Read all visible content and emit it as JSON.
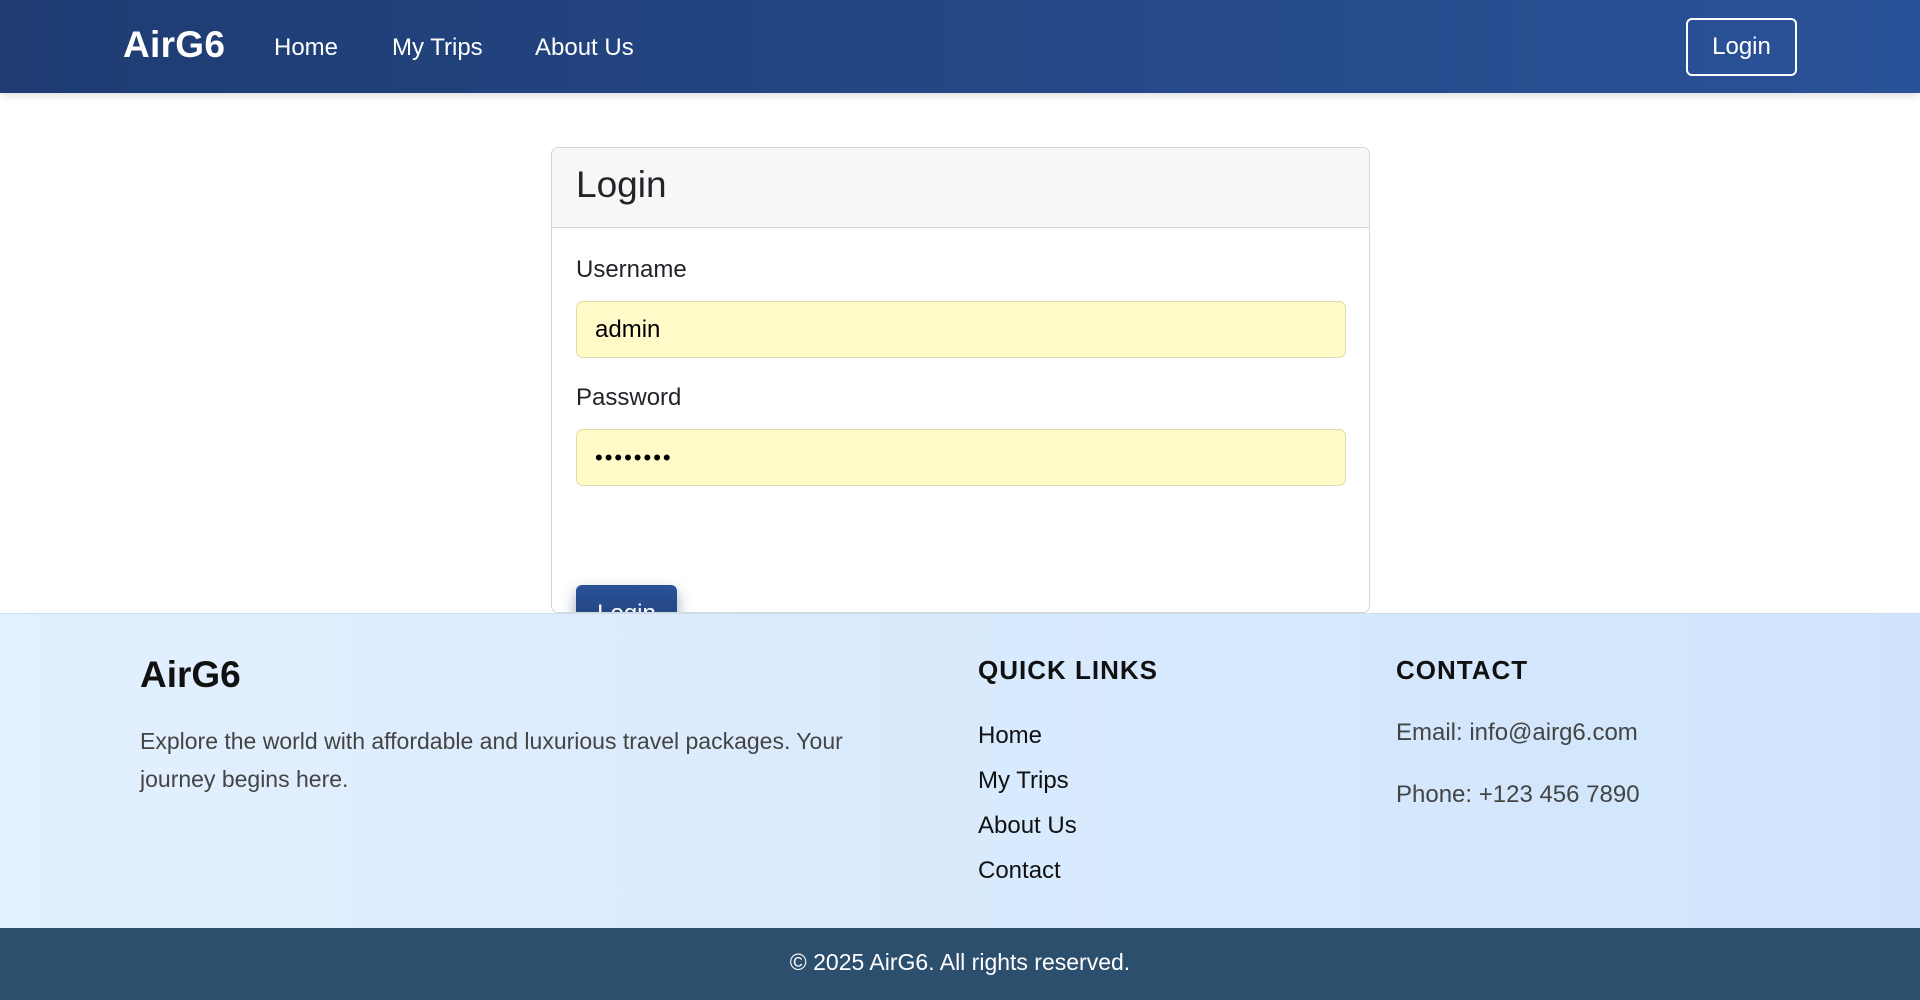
{
  "navbar": {
    "brand": "AirG6",
    "links": [
      "Home",
      "My Trips",
      "About Us"
    ],
    "login_label": "Login"
  },
  "login_card": {
    "title": "Login",
    "username_label": "Username",
    "username_value": "admin",
    "password_label": "Password",
    "password_value": "••••••••",
    "submit_label": "Login"
  },
  "footer": {
    "brand": "AirG6",
    "description": "Explore the world with affordable and luxurious travel packages. Your journey begins here.",
    "quick_links_heading": "QUICK LINKS",
    "quick_links": [
      "Home",
      "My Trips",
      "About Us",
      "Contact"
    ],
    "contact_heading": "CONTACT",
    "email": "Email: info@airg6.com",
    "phone": "Phone: +123 456 7890",
    "copyright": "© 2025 AirG6. All rights reserved."
  },
  "colors": {
    "navbar_start": "#1e3c72",
    "navbar_end": "#2a5298",
    "input_autofill": "#fffac8",
    "footer_bg": "#d9eafd",
    "copyright_bg": "#2c4f6e"
  }
}
